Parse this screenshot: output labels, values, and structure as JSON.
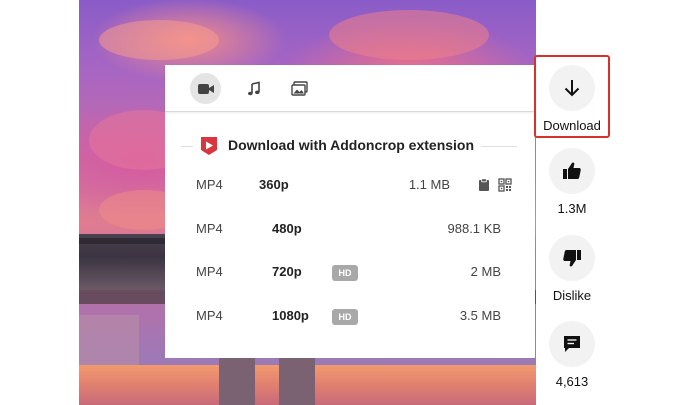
{
  "popup": {
    "tabs": [
      {
        "name": "video",
        "icon": "video-camera-icon",
        "active": true
      },
      {
        "name": "audio",
        "icon": "music-note-icon",
        "active": false
      },
      {
        "name": "images",
        "icon": "image-gallery-icon",
        "active": false
      }
    ],
    "heading": "Download with Addoncrop extension",
    "logo_color": "#d9363e",
    "rows": [
      {
        "format": "MP4",
        "resolution": "360p",
        "hd": "",
        "size": "1.1 MB",
        "has_tools": true
      },
      {
        "format": "MP4",
        "resolution": "480p",
        "hd": "",
        "size": "988.1 KB",
        "has_tools": false
      },
      {
        "format": "MP4",
        "resolution": "720p",
        "hd": "HD",
        "size": "2 MB",
        "has_tools": false
      },
      {
        "format": "MP4",
        "resolution": "1080p",
        "hd": "HD",
        "size": "3.5 MB",
        "has_tools": false
      }
    ]
  },
  "actions": {
    "download": {
      "label": "Download",
      "icon": "arrow-down-icon",
      "highlight_color": "#d8312b"
    },
    "like": {
      "label": "1.3M",
      "icon": "thumbs-up-icon"
    },
    "dislike": {
      "label": "Dislike",
      "icon": "thumbs-down-icon"
    },
    "comments": {
      "label": "4,613",
      "icon": "comment-icon"
    }
  }
}
